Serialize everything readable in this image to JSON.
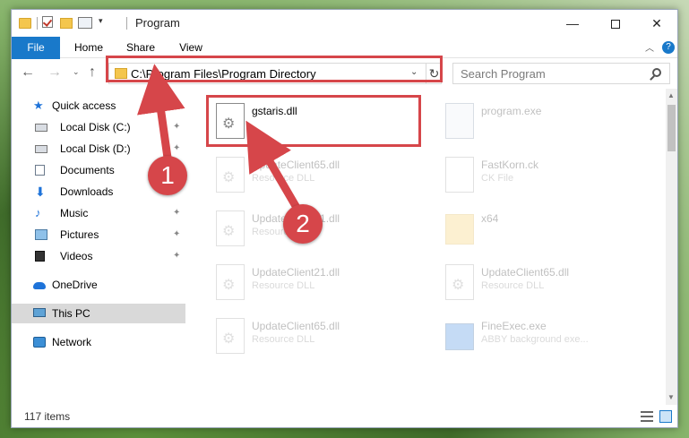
{
  "window": {
    "title": "Program",
    "minimize_glyph": "—",
    "close_glyph": "✕"
  },
  "ribbon": {
    "tabs": [
      "File",
      "Home",
      "Share",
      "View"
    ],
    "help_glyph": "?",
    "collapse_glyph": "︿"
  },
  "address": {
    "path": "C:\\Program Files\\Program Directory",
    "dropdown_glyph": "⌄",
    "refresh_glyph": "↻"
  },
  "nav_buttons": {
    "back": "←",
    "forward": "→",
    "recent": "⌄",
    "up": "↑"
  },
  "search": {
    "placeholder": "Search Program"
  },
  "sidebar": {
    "items": [
      {
        "label": "Quick access",
        "icon": "star-icon",
        "pinned": false
      },
      {
        "label": "Local Disk (C:)",
        "icon": "disk-icon",
        "pinned": true
      },
      {
        "label": "Local Disk (D:)",
        "icon": "disk-icon",
        "pinned": true
      },
      {
        "label": "Documents",
        "icon": "documents-icon",
        "pinned": true
      },
      {
        "label": "Downloads",
        "icon": "downloads-icon",
        "pinned": true
      },
      {
        "label": "Music",
        "icon": "music-icon",
        "pinned": true
      },
      {
        "label": "Pictures",
        "icon": "pictures-icon",
        "pinned": true
      },
      {
        "label": "Videos",
        "icon": "videos-icon",
        "pinned": true
      },
      {
        "label": "OneDrive",
        "icon": "cloud-icon",
        "pinned": false
      },
      {
        "label": "This PC",
        "icon": "pc-icon",
        "pinned": false,
        "selected": true
      },
      {
        "label": "Network",
        "icon": "network-icon",
        "pinned": false
      }
    ],
    "pin_glyph": "📌"
  },
  "files": [
    {
      "name": "gstaris.dll",
      "type": "",
      "icon": "dll-icon",
      "highlighted": true
    },
    {
      "name": "program.exe",
      "type": "",
      "icon": "exe-icon"
    },
    {
      "name": "UpdateClient65.dll",
      "type": "Resource DLL",
      "icon": "dll-icon"
    },
    {
      "name": "FastKorn.ck",
      "type": "CK File",
      "icon": "ck-icon"
    },
    {
      "name": "UpdateClient21.dll",
      "type": "Resource DLL",
      "icon": "dll-icon"
    },
    {
      "name": "x64",
      "type": "",
      "icon": "folder-icon"
    },
    {
      "name": "UpdateClient21.dll",
      "type": "Resource DLL",
      "icon": "dll-icon"
    },
    {
      "name": "UpdateClient65.dll",
      "type": "Resource DLL",
      "icon": "dll-icon"
    },
    {
      "name": "UpdateClient65.dll",
      "type": "Resource DLL",
      "icon": "dll-icon"
    },
    {
      "name": "FineExec.exe",
      "type": "ABBY background exe...",
      "icon": "app-icon"
    }
  ],
  "status": {
    "item_count": "117 items"
  },
  "annotations": {
    "step1": "1",
    "step2": "2",
    "accent": "#d6464a"
  },
  "colors": {
    "file_tab": "#1979ca",
    "selected_nav": "#d9d9d9"
  }
}
